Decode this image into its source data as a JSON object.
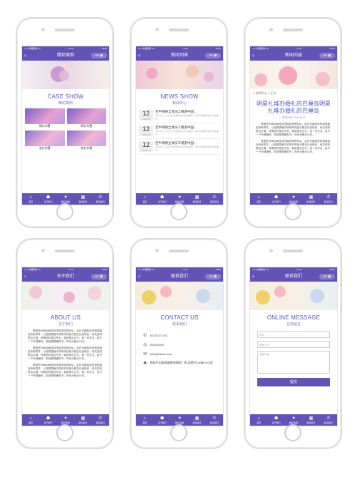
{
  "status": {
    "carrier": "••••• 中国联通 4G",
    "time": "12:00",
    "battery": "100%"
  },
  "tabs": [
    {
      "icon": "home-icon",
      "glyph": "⌂",
      "label": "首页"
    },
    {
      "icon": "users-icon",
      "glyph": "☗",
      "label": "关于我们"
    },
    {
      "icon": "heart-icon",
      "glyph": "♥",
      "label": "精彩案例"
    },
    {
      "icon": "grid-icon",
      "glyph": "▦",
      "label": "新闻资讯"
    },
    {
      "icon": "phone-icon",
      "glyph": "✆",
      "label": "联系我们"
    }
  ],
  "case_show": {
    "nav_title": "精彩案例",
    "heading_en": "CASE SHOW",
    "heading_cn": "精彩案例",
    "items": [
      "简礼布置",
      "简礼布置",
      "浪礼布置",
      "浪礼布置"
    ]
  },
  "news_show": {
    "nav_title": "新闻列表",
    "heading_en": "NEWS SHOW",
    "heading_cn": "新闻中心",
    "items": [
      {
        "day": "12",
        "ym": "2016-06",
        "title": "百牛网络全体员工畅游中国...",
        "summary": "4月26日，在上七日次团队的户外拓展中，我们为期两天的户外拓展在..."
      },
      {
        "day": "12",
        "ym": "2016-06",
        "title": "百牛网络全体员工畅游中国...",
        "summary": "4月26日，在上七日次团队的户外拓展中，我们为期两天的户外拓展在..."
      },
      {
        "day": "12",
        "ym": "2016-06",
        "title": "百牛网络全体员工畅游中国...",
        "summary": "4月26日，在上七日次团队的户外拓展中，我们为期两天的户外拓展在..."
      }
    ]
  },
  "news_detail": {
    "nav_title": "新闻内容",
    "location": "新闻中心 > 正文",
    "title": "明星扎堆办婚礼的巴厘岛明星扎堆办婚礼的巴厘岛",
    "date": "发布时间 2016-06-08",
    "paragraphs": [
      "美国专利商标局收到杰森申请资料后，会先详细检验申请表格及所有附件，以查看表格内须填写的部分是否已经填妥，有关资料是否正确，所需资料是否齐全，费用是否交付，如一切妥当，给予一个申请编号，发放受理通知书，时间大概为15天。",
      "美国专利商标局收到杰森申请资料后，会先详细检验申请表格及所有附件，以查看表格内须填写的部分是否已经填妥，有关资料是否正确，所需资料是否齐全，费用是否交付，如一切妥当，给予一个申请编号，发放受理通知书，时间大概为15天。"
    ]
  },
  "about": {
    "nav_title": "关于我们",
    "heading_en": "ABOUT US",
    "heading_cn": "关于我们",
    "paragraphs": [
      "美国专利商标局收到杰森申请资料后，会先详细检验申请表格及所有附件，以查看表格内须填写的部分是否已经填妥，有关资料是否正确，所需资料是否齐全，费用是否交付，如一切妥当，给予一个申请编号，发放受理通知书，时间大概为15天。",
      "美国专利商标局收到杰森申请资料后，会先详细检验申请表格及所有附件，以查看表格内须填写的部分是否已经填妥，有关资料是否正确，所需资料是否齐全，费用是否交付，如一切妥当，给予一个申请编号，发放受理通知书，时间大概为15天。",
      "美国专利商标局收到杰森申请资料后，会先详细检验申请表格及所有附件，以查看表格内须填写的部分是否已经填妥，有关资料是否正确，所需资料是否齐全，费用是否交付，如一切妥当，给予一个申请编号，发放受理通知书，时间大概为15天。"
    ]
  },
  "contact": {
    "nav_title": "联系我们",
    "heading_en": "CONTACT US",
    "heading_cn": "联系我们",
    "phone": "400-0377-002",
    "qq": "000000000",
    "email": "kefu@bainiu.com",
    "address": "南阳市北路南路建业路南广场 北楼中心B座5102室"
  },
  "message": {
    "nav_title": "联系我们",
    "heading_en": "ONLINE MESSAGE",
    "heading_cn": "在线留言",
    "name_placeholder": "姓名",
    "phone_placeholder": "联系方式",
    "content_placeholder": "留言内容",
    "submit_label": "提交"
  },
  "colors": {
    "brand": "#6253b5",
    "heading": "#5b55c2"
  }
}
